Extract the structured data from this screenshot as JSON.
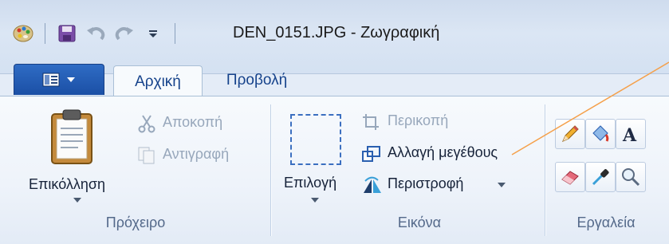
{
  "window": {
    "title": "DEN_0151.JPG - Ζωγραφική"
  },
  "tabs": {
    "home": "Αρχική",
    "view": "Προβολή"
  },
  "clipboard": {
    "paste": "Επικόλληση",
    "cut": "Αποκοπή",
    "copy": "Αντιγραφή",
    "group_label": "Πρόχειρο"
  },
  "image": {
    "select": "Επιλογή",
    "crop": "Περικοπή",
    "resize": "Αλλαγή μεγέθους",
    "rotate": "Περιστροφή",
    "group_label": "Εικόνα"
  },
  "tools": {
    "group_label": "Εργαλεία",
    "items": [
      "pencil-icon",
      "fill-icon",
      "text-icon",
      "eraser-icon",
      "color-picker-icon",
      "magnifier-icon"
    ]
  },
  "colors": {
    "file_tab": "#1b4fa5",
    "annotation_line": "#f5a04a"
  }
}
